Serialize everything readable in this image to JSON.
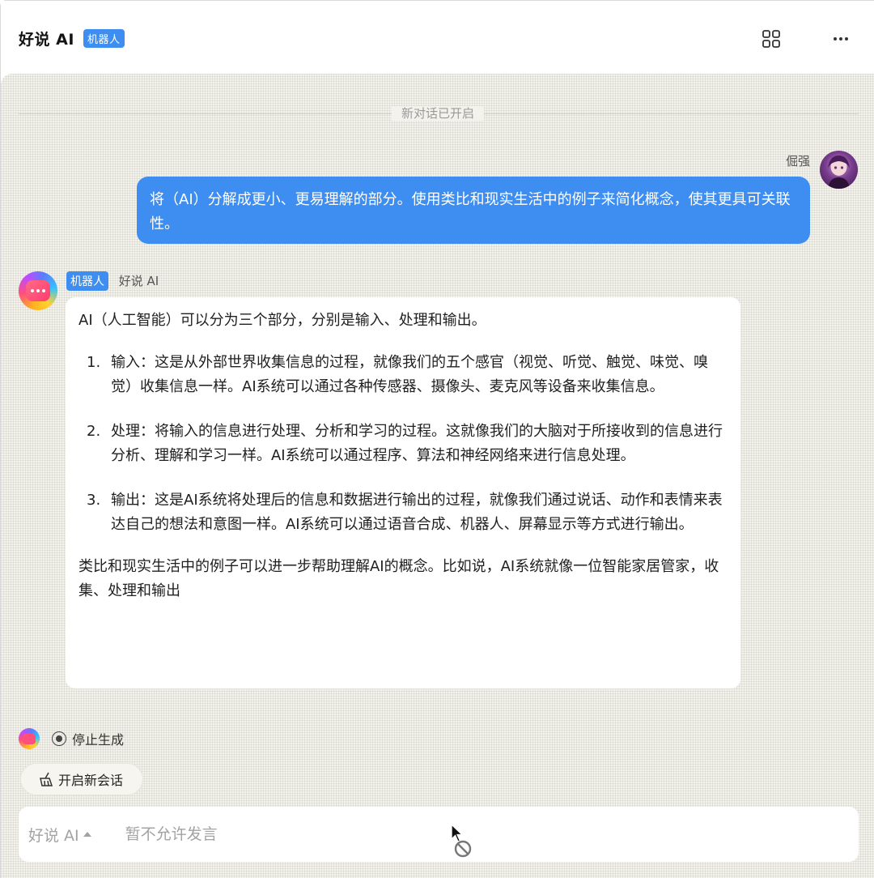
{
  "header": {
    "title": "好说 AI",
    "tag": "机器人",
    "icons": [
      "apps-grid-icon",
      "more-icon"
    ]
  },
  "chat": {
    "divider_label": "新对话已开启",
    "user": {
      "name": "倔强",
      "message": "将（AI）分解成更小、更易理解的部分。使用类比和现实生活中的例子来简化概念，使其更具可关联性。"
    },
    "bot": {
      "tag": "机器人",
      "name": "好说 AI",
      "intro": "AI（人工智能）可以分为三个部分，分别是输入、处理和输出。",
      "items": [
        {
          "num": "1.",
          "text": "输入：这是从外部世界收集信息的过程，就像我们的五个感官（视觉、听觉、触觉、味觉、嗅觉）收集信息一样。AI系统可以通过各种传感器、摄像头、麦克风等设备来收集信息。"
        },
        {
          "num": "2.",
          "text": "处理：将输入的信息进行处理、分析和学习的过程。这就像我们的大脑对于所接收到的信息进行分析、理解和学习一样。AI系统可以通过程序、算法和神经网络来进行信息处理。"
        },
        {
          "num": "3.",
          "text": "输出：这是AI系统将处理后的信息和数据进行输出的过程，就像我们通过说话、动作和表情来表达自己的想法和意图一样。AI系统可以通过语音合成、机器人、屏幕显示等方式进行输出。"
        }
      ],
      "outro": "类比和现实生活中的例子可以进一步帮助理解AI的概念。比如说，AI系统就像一位智能家居管家，收集、处理和输出"
    },
    "stop_label": "停止生成",
    "new_chat_label": "开启新会话"
  },
  "composer": {
    "agent": "好说 AI",
    "placeholder": "暂不允许发言"
  }
}
